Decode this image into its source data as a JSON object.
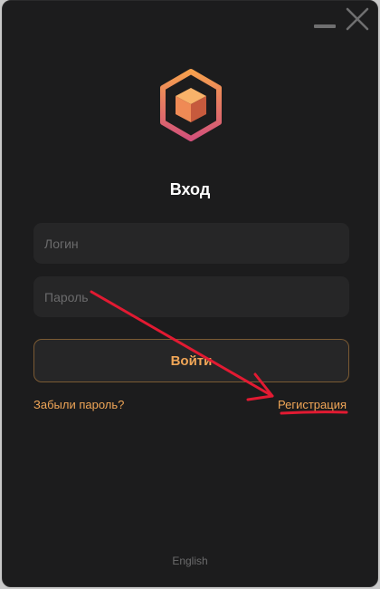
{
  "window": {
    "controls": {
      "minimize_icon": "minimize-icon",
      "close_icon": "close-icon"
    }
  },
  "logo": {
    "icon": "hexagon-cube-logo",
    "colors": {
      "ring_top": "#f6a04d",
      "ring_bottom": "#d2517a",
      "cube_light": "#f8b36a",
      "cube_mid": "#ef8a55",
      "cube_dark": "#c65a3d"
    }
  },
  "login_form": {
    "title": "Вход",
    "login_placeholder": "Логин",
    "password_placeholder": "Пароль",
    "submit_label": "Войти",
    "forgot_password_label": "Забыли пароль?",
    "register_label": "Регистрация"
  },
  "footer": {
    "language_label": "English"
  },
  "colors": {
    "accent": "#f0a657",
    "background": "#1c1c1d",
    "field": "#262627",
    "annotation_red": "#e21a32"
  }
}
